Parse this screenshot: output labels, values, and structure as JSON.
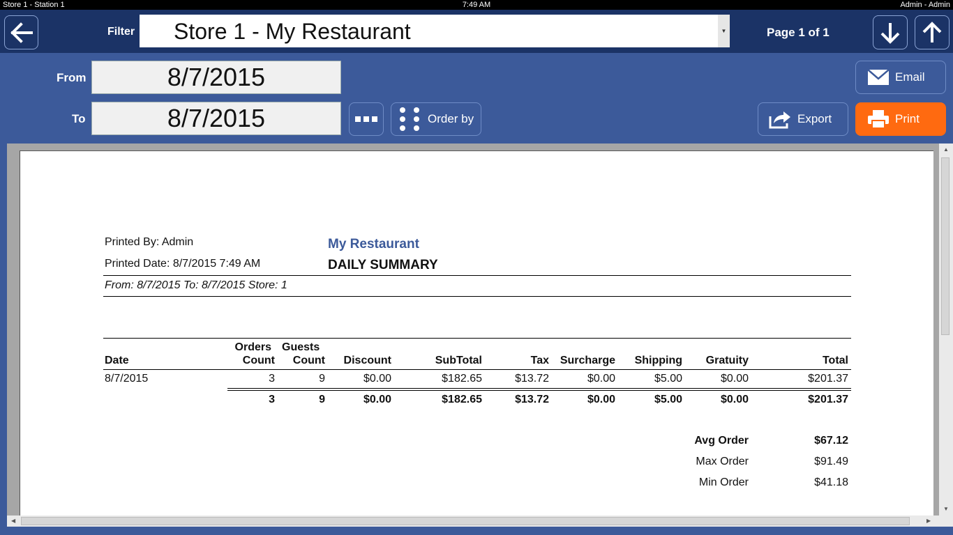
{
  "statusbar": {
    "left": "Store 1 - Station 1",
    "center": "7:49 AM",
    "right": "Admin - Admin"
  },
  "toolbar": {
    "filter_label": "Filter",
    "filter_value": "Store 1 - My Restaurant",
    "page_indicator": "Page 1 of 1"
  },
  "dates": {
    "from_label": "From",
    "from_value": "8/7/2015",
    "to_label": "To",
    "to_value": "8/7/2015"
  },
  "actions": {
    "order_by": "Order by",
    "email": "Email",
    "export": "Export",
    "print": "Print"
  },
  "colors": {
    "header": "#1b3366",
    "body": "#3c5a9a",
    "print_accent": "#ff6a10"
  },
  "report": {
    "printed_by": "Printed By: Admin",
    "printed_date": "Printed Date: 8/7/2015 7:49 AM",
    "restaurant": "My Restaurant",
    "report_title": "DAILY SUMMARY",
    "criteria": "From: 8/7/2015 To: 8/7/2015   Store: 1",
    "columns": {
      "date": "Date",
      "orders_top": "Orders",
      "orders_bottom": "Count",
      "guests_top": "Guests",
      "guests_bottom": "Count",
      "discount": "Discount",
      "subtotal": "SubTotal",
      "tax": "Tax",
      "surcharge": "Surcharge",
      "shipping": "Shipping",
      "gratuity": "Gratuity",
      "total": "Total"
    },
    "rows": [
      {
        "date": "8/7/2015",
        "orders": "3",
        "guests": "9",
        "discount": "$0.00",
        "subtotal": "$182.65",
        "tax": "$13.72",
        "surcharge": "$0.00",
        "shipping": "$5.00",
        "gratuity": "$0.00",
        "total": "$201.37"
      }
    ],
    "totals": {
      "orders": "3",
      "guests": "9",
      "discount": "$0.00",
      "subtotal": "$182.65",
      "tax": "$13.72",
      "surcharge": "$0.00",
      "shipping": "$5.00",
      "gratuity": "$0.00",
      "total": "$201.37"
    },
    "stats": {
      "avg_label": "Avg Order",
      "avg_value": "$67.12",
      "max_label": "Max Order",
      "max_value": "$91.49",
      "min_label": "Min Order",
      "min_value": "$41.18"
    }
  }
}
